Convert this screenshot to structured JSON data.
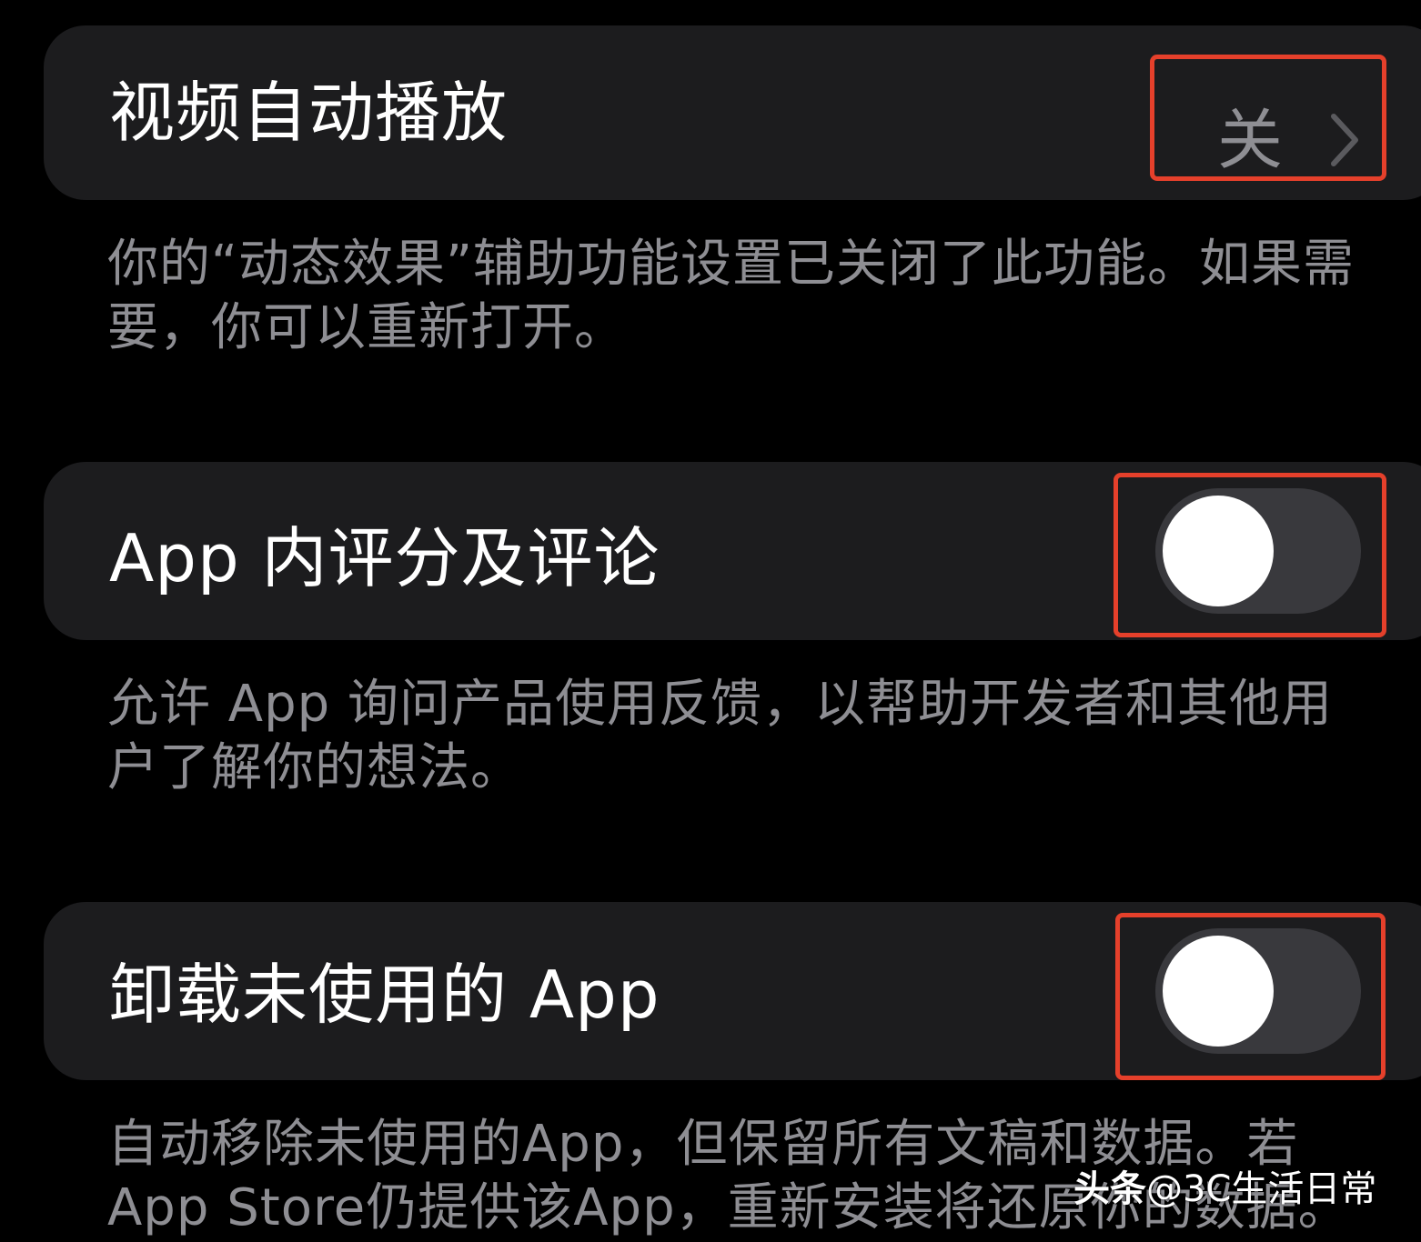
{
  "colors": {
    "background": "#000000",
    "card": "#1c1c1e",
    "label": "#ffffff",
    "secondary": "#8e8e93",
    "toggle_off_track": "#39393d",
    "highlight": "#e5402b"
  },
  "rows": [
    {
      "label": "视频自动播放",
      "value": "关",
      "accessory": "chevron-right-icon",
      "footer": "你的“动态效果”辅助功能设置已关闭了此功能。如果需要，你可以重新打开。"
    },
    {
      "label": "App 内评分及评论",
      "toggle_on": false,
      "footer": "允许 App 询问产品使用反馈，以帮助开发者和其他用户了解你的想法。"
    },
    {
      "label": "卸载未使用的 App",
      "toggle_on": false,
      "footer": "自动移除未使用的App，但保留所有文稿和数据。若App Store仍提供该App，重新安装将还原你的数据。"
    }
  ],
  "watermark": {
    "brand": "头条",
    "handle": "@3C生活日常"
  }
}
